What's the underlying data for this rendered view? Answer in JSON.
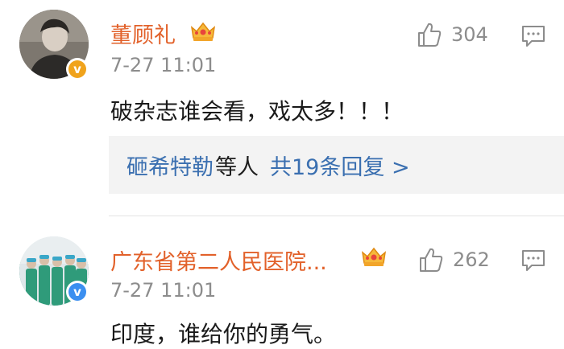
{
  "comments": [
    {
      "username": "董顾礼",
      "timestamp": "7-27 11:01",
      "text": "破杂志谁会看，戏太多！！！",
      "likes": "304",
      "badge": "v",
      "replies": {
        "names": "砸希特勒",
        "suffix": "等人",
        "count_text": "共19条回复 >"
      }
    },
    {
      "username": "广东省第二人民医院...",
      "timestamp": "7-27 11:01",
      "text": "印度，谁给你的勇气。",
      "likes": "262",
      "badge": "v"
    }
  ],
  "colors": {
    "username": "#e2612a",
    "link": "#3a6fb0",
    "muted": "#8c8c8c",
    "badge_orange": "#f0a31c",
    "badge_blue": "#3b8ff0"
  },
  "icons": {
    "like": "thumbs-up-icon",
    "reply": "comment-icon",
    "crown": "crown-icon"
  }
}
